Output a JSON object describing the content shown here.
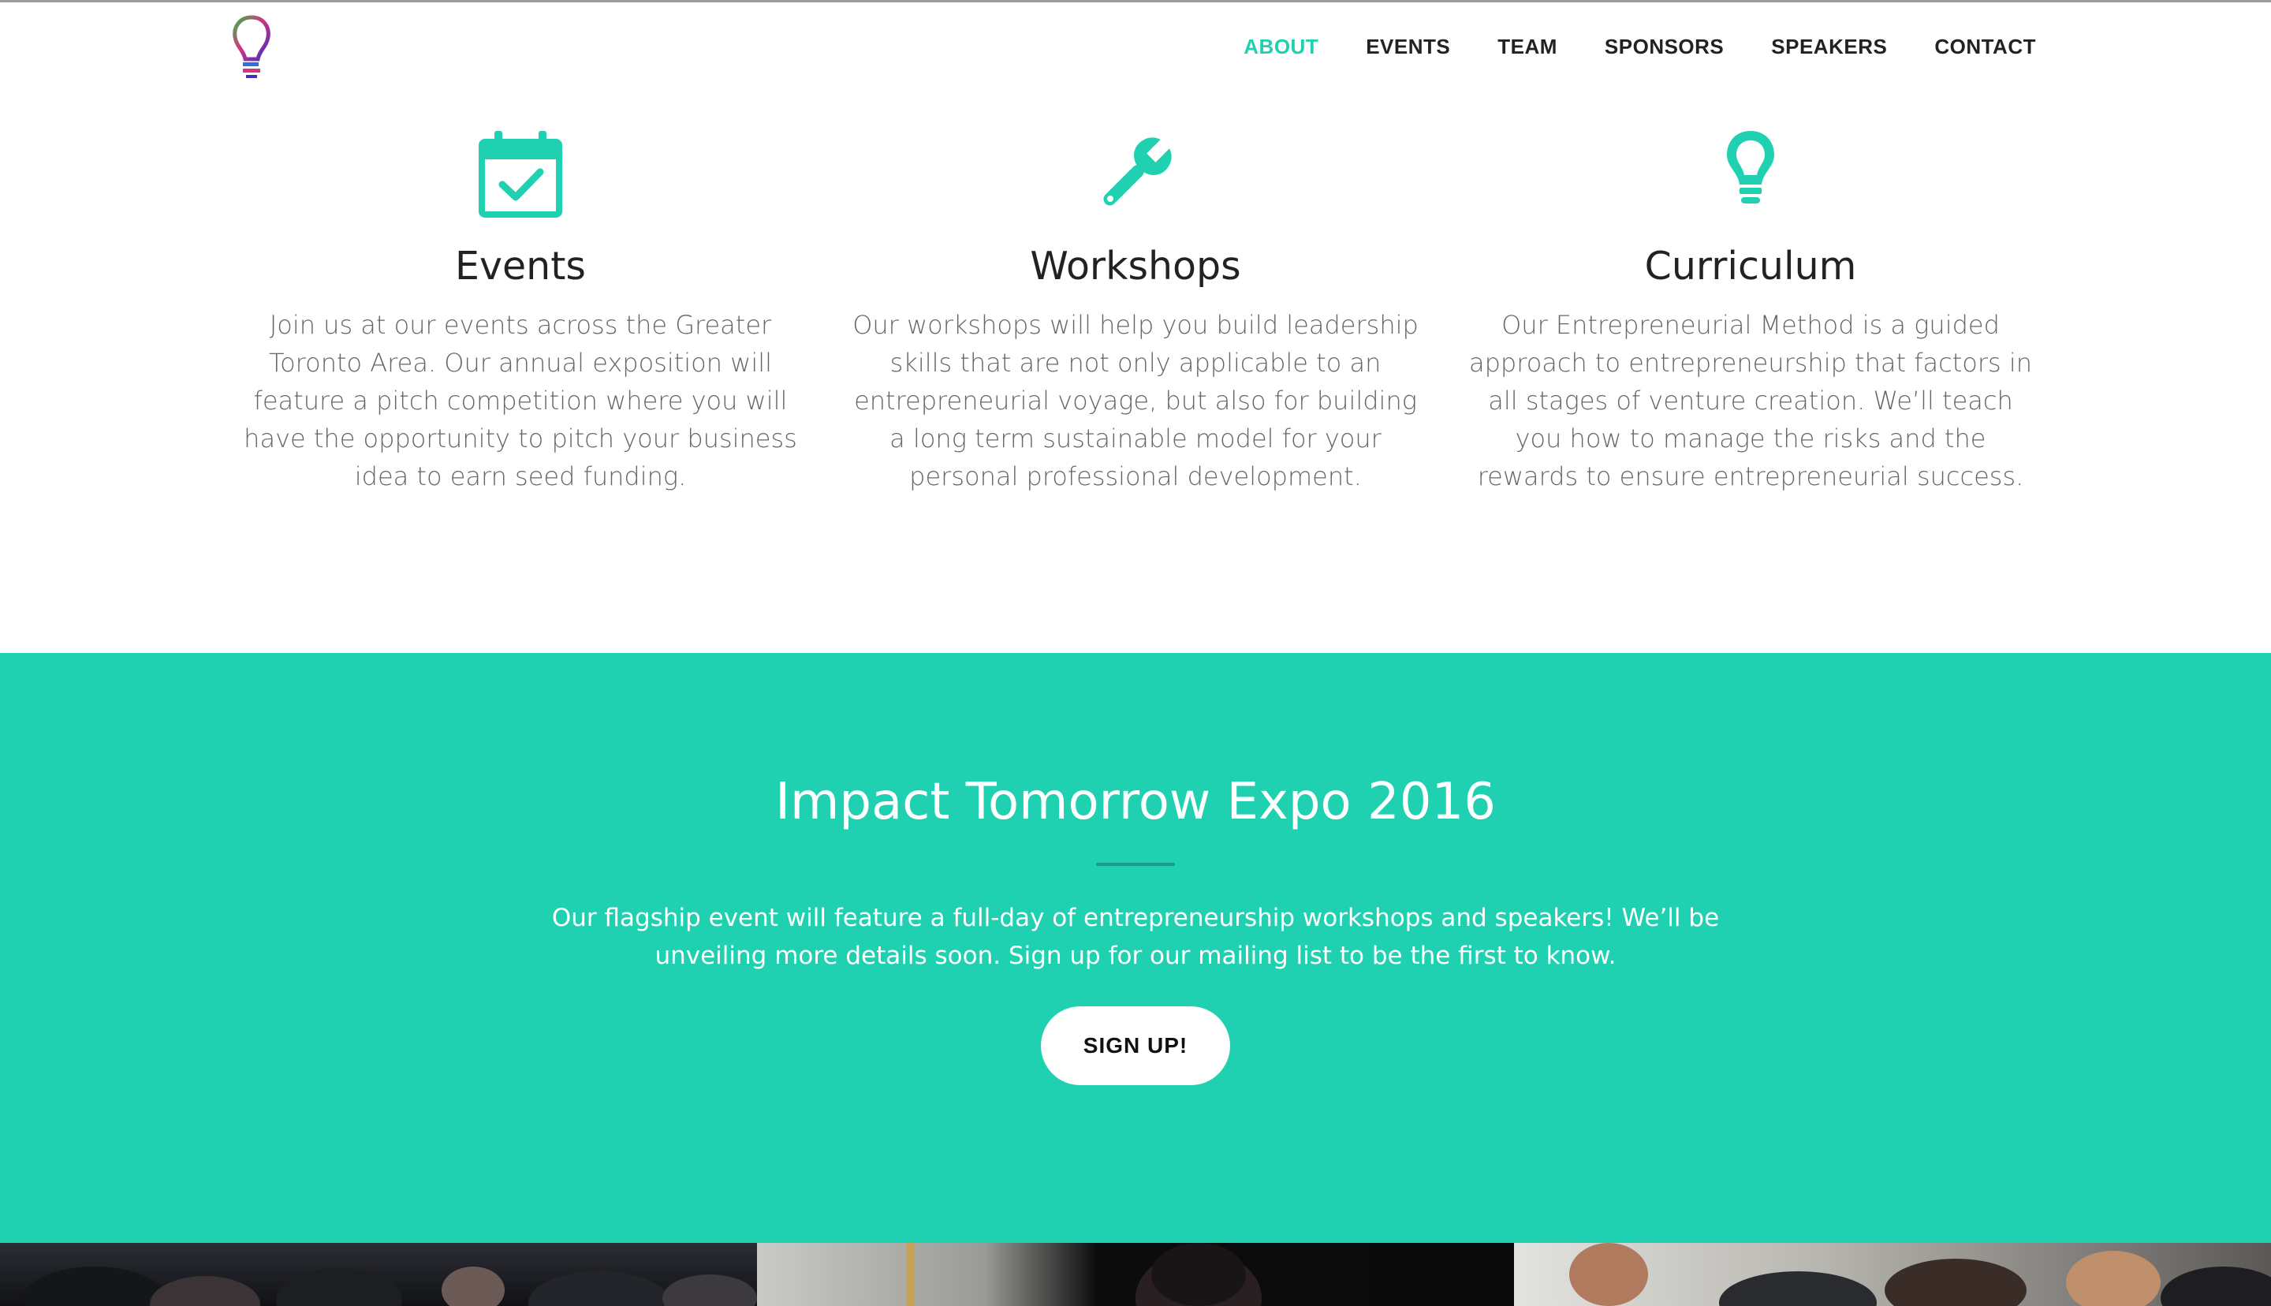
{
  "nav": {
    "items": [
      {
        "label": "ABOUT",
        "active": true
      },
      {
        "label": "EVENTS",
        "active": false
      },
      {
        "label": "TEAM",
        "active": false
      },
      {
        "label": "SPONSORS",
        "active": false
      },
      {
        "label": "SPEAKERS",
        "active": false
      },
      {
        "label": "CONTACT",
        "active": false
      }
    ]
  },
  "features": [
    {
      "icon": "calendar-check-icon",
      "title": "Events",
      "text": "Join us at our events across the Greater Toronto Area. Our annual exposition will feature a pitch competition where you will have the opportunity to pitch your business idea to earn seed funding."
    },
    {
      "icon": "wrench-icon",
      "title": "Workshops",
      "text": "Our workshops will help you build leadership skills that are not only applicable to an entrepreneurial voyage, but also for building a long term sustainable model for your personal professional development."
    },
    {
      "icon": "lightbulb-icon",
      "title": "Curriculum",
      "text": "Our Entrepreneurial Method is a guided approach to entrepreneurship that factors in all stages of venture creation. We’ll teach you how to manage the risks and the rewards to ensure entrepreneurial success."
    }
  ],
  "banner": {
    "title": "Impact Tomorrow Expo 2016",
    "text": "Our flagship event will feature a full-day of entrepreneurship workshops and speakers! We’ll be unveiling more details soon. Sign up for our mailing list to be the first to know.",
    "button_label": "SIGN UP!"
  },
  "colors": {
    "accent": "#1fd1b0",
    "divider": "#1a9e86",
    "heading": "#222222",
    "body_text": "#666666"
  }
}
